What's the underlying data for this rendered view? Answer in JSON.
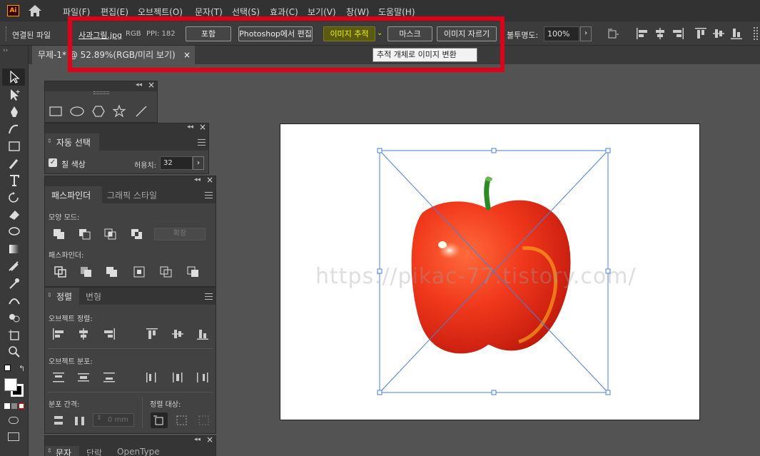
{
  "app": {
    "logo_text": "Ai"
  },
  "menu": [
    "파일(F)",
    "편집(E)",
    "오브젝트(O)",
    "문자(T)",
    "선택(S)",
    "효과(C)",
    "보기(V)",
    "창(W)",
    "도움말(H)"
  ],
  "control_bar": {
    "linked_file_label": "연결된 파일",
    "file_name": "사과그림.jpg",
    "color_mode": "RGB",
    "ppi": "PPI: 182",
    "embed_button": "포함",
    "edit_photoshop_button": "Photoshop에서 편집",
    "image_trace_button": "이미지 추적",
    "mask_button": "마스크",
    "crop_image_button": "이미지 자르기",
    "opacity_label": "불투명도:",
    "opacity_value": "100%"
  },
  "document_tab": {
    "title": "무제-1* @ 52.89%(RGB/미리 보기)",
    "close_glyph": "×"
  },
  "tooltip": {
    "text": "추적 개체로 이미지 변환"
  },
  "panels": {
    "magic_wand": {
      "tab": "자동 선택",
      "fill_color_label": "칠 색상",
      "fill_checked": true,
      "tolerance_label": "허용치:",
      "tolerance_value": "32"
    },
    "pathfinder": {
      "tabs": [
        "패스파인더",
        "그래픽 스타일"
      ],
      "shape_modes_label": "모양 모드:",
      "expand_button": "확장",
      "pathfinders_label": "패스파인더:"
    },
    "align": {
      "tabs": [
        "정렬",
        "변형"
      ],
      "align_objects_label": "오브젝트 정렬:",
      "distribute_objects_label": "오브젝트 분포:",
      "distribute_spacing_label": "분포 간격:",
      "spacing_value": "0 mm",
      "align_to_label": "정렬 대상:"
    },
    "character": {
      "tabs": [
        "문자",
        "단락",
        "OpenType"
      ]
    }
  },
  "canvas": {
    "watermark": "https://pikac-77.tistory.com/"
  },
  "colors": {
    "highlight": "#e0001a",
    "selection": "#4a7fd8",
    "trace_button_text": "#f4f400"
  }
}
